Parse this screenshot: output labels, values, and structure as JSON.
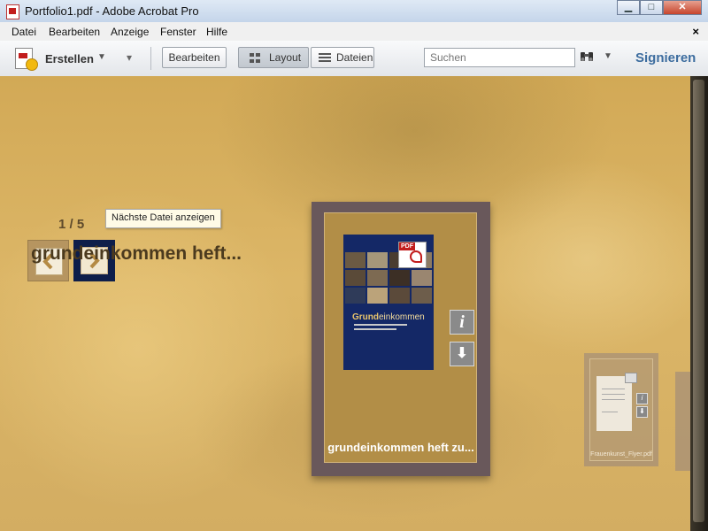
{
  "window": {
    "title": "Portfolio1.pdf - Adobe Acrobat Pro",
    "controls": {
      "minimize": "▁",
      "maximize": "□",
      "close": "✕"
    }
  },
  "menu": {
    "items": [
      "Datei",
      "Bearbeiten",
      "Anzeige",
      "Fenster",
      "Hilfe"
    ],
    "close": "×"
  },
  "toolbar": {
    "create_label": "Erstellen",
    "edit_label": "Bearbeiten",
    "layout_label": "Layout",
    "files_label": "Dateien",
    "search_placeholder": "Suchen",
    "sign_label": "Signieren"
  },
  "portfolio": {
    "counter": "1 / 5",
    "current_title": "grundeinkommen heft...",
    "tooltip": "Nächste Datei anzeigen",
    "main_card": {
      "label": "grundeinkommen heft zu...",
      "cover_brand": "Grund",
      "cover_brand_rest": "einkommen",
      "badge": "PDF"
    },
    "side_card": {
      "label": "Frauenkunst_Flyer.pdf"
    }
  },
  "colors": {
    "accent": "#3d6d9f",
    "nav_active": "#0e1e4a",
    "card_frame": "#69585b",
    "background": "#d7af5e"
  }
}
